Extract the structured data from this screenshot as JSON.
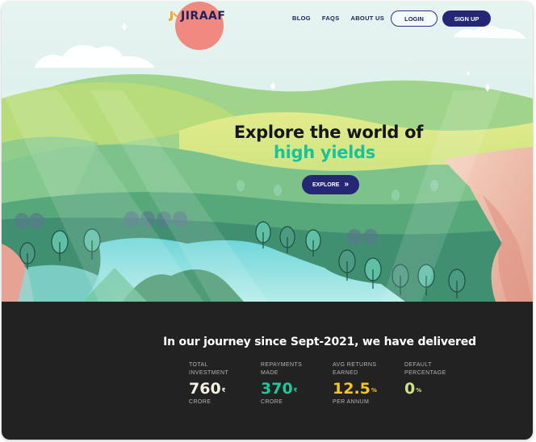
{
  "brand": {
    "name": "JIRAAF",
    "accent_color": "#232775",
    "highlight_color": "#19c29a",
    "sun_color": "#f08a80"
  },
  "nav": {
    "links": [
      "BLOG",
      "FAQS",
      "ABOUT US"
    ],
    "login_label": "LOGIN",
    "signup_label": "SIGN UP"
  },
  "hero": {
    "headline_line1": "Explore the world of",
    "headline_line2": "high yields",
    "explore_label": "EXPLORE",
    "explore_icon": "double-chevron-right-icon"
  },
  "stats": {
    "title": "In our journey since Sept-2021, we have delivered",
    "items": [
      {
        "label_line1": "TOTAL",
        "label_line2": "INVESTMENT",
        "value": "760",
        "suffix": "₹",
        "unit": "CRORE",
        "color": "#f6f0e4"
      },
      {
        "label_line1": "REPAYMENTS",
        "label_line2": "MADE",
        "value": "370",
        "suffix": "₹",
        "unit": "CRORE",
        "color": "#21c79a"
      },
      {
        "label_line1": "AVG RETURNS",
        "label_line2": "EARNED",
        "value": "12.5",
        "suffix": "%",
        "unit": "PER ANNUM",
        "color": "#f3c623"
      },
      {
        "label_line1": "DEFAULT",
        "label_line2": "PERCENTAGE",
        "value": "0",
        "suffix": "%",
        "unit": "",
        "color": "#cfe28a"
      }
    ]
  }
}
